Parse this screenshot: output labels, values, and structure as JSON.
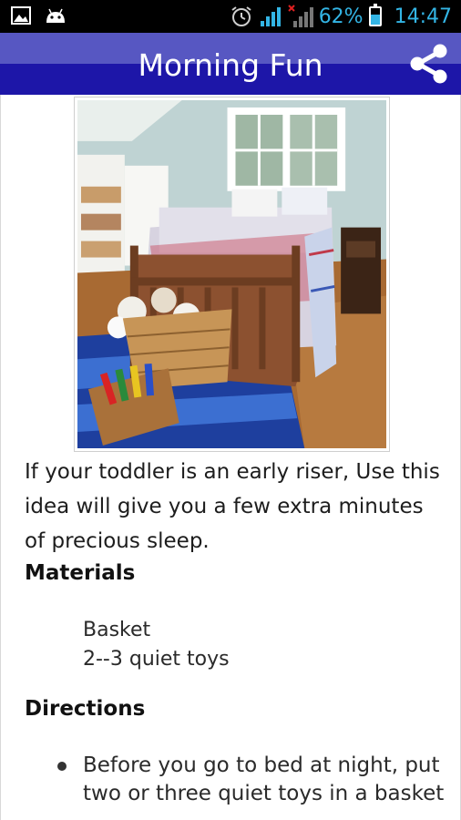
{
  "status_bar": {
    "battery_percent": "62%",
    "battery_level": 0.62,
    "clock": "14:47",
    "icons": [
      "image-icon",
      "android-icon",
      "alarm-icon",
      "signal-icon",
      "no-signal-icon",
      "battery-charging-icon"
    ]
  },
  "action_bar": {
    "title": "Morning Fun",
    "share_icon": "share-icon",
    "colors": {
      "bar_top": "#5757c2",
      "bar_bottom": "#1d16a8"
    }
  },
  "article": {
    "intro": "If your toddler is an early riser, Use this idea will give you a few extra minutes of precious sleep.",
    "materials_heading": "Materials",
    "materials": [
      "Basket",
      "2--3 quiet toys"
    ],
    "directions_heading": "Directions",
    "directions": [
      "Before you go to bed at night, put two or three quiet toys in a basket"
    ]
  }
}
